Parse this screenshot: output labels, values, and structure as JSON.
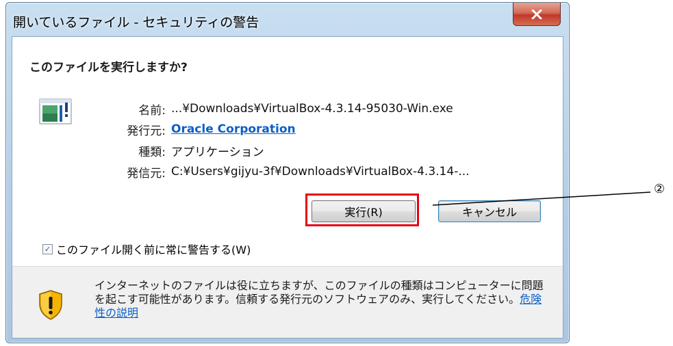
{
  "window": {
    "title": "開いているファイル - セキュリティの警告",
    "close_label": "X"
  },
  "dialog": {
    "heading": "このファイルを実行しますか?",
    "file_icon": "application-file-icon",
    "fields": {
      "name_label": "名前:",
      "name_value": "...¥Downloads¥VirtualBox-4.3.14-95030-Win.exe",
      "publisher_label": "発行元:",
      "publisher_value": "Oracle Corporation",
      "type_label": "種類:",
      "type_value": "アプリケーション",
      "from_label": "発信元:",
      "from_value": "C:¥Users¥gijyu-3f¥Downloads¥VirtualBox-4.3.14-..."
    },
    "buttons": {
      "run_label": "実行(R)",
      "cancel_label": "キャンセル"
    },
    "checkbox": {
      "label": "このファイル開く前に常に警告する(W)",
      "checked": true
    },
    "warning": {
      "icon": "shield-warning-icon",
      "text": "インターネットのファイルは役に立ちますが、このファイルの種類はコンピューターに問題を起こす可能性があります。信頼する発行元のソフトウェアのみ、実行してください。",
      "link_text": "危険性の説明"
    }
  },
  "annotation": {
    "marker": "②",
    "highlight_color": "#e60012"
  }
}
